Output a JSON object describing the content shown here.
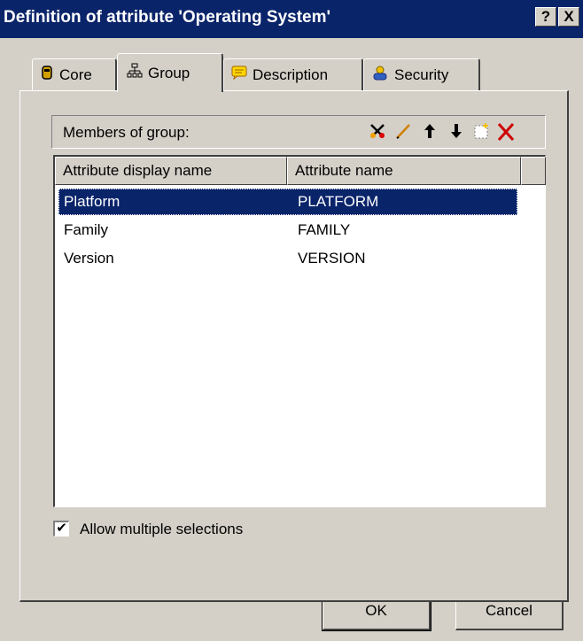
{
  "window": {
    "title": "Definition of attribute 'Operating System'",
    "help_label": "?",
    "close_label": "X"
  },
  "tabs": [
    {
      "label": "Core",
      "icon": "core-icon"
    },
    {
      "label": "Group",
      "icon": "group-icon",
      "active": true
    },
    {
      "label": "Description",
      "icon": "description-icon"
    },
    {
      "label": "Security",
      "icon": "security-icon"
    }
  ],
  "members": {
    "label": "Members of group:",
    "toolbar_icons": [
      "cut-icon",
      "edit-icon",
      "up-arrow-icon",
      "down-arrow-icon",
      "new-icon",
      "delete-icon"
    ]
  },
  "list": {
    "columns": [
      "Attribute display name",
      "Attribute name"
    ],
    "rows": [
      {
        "display": "Platform",
        "name": "PLATFORM",
        "selected": true
      },
      {
        "display": "Family",
        "name": "FAMILY"
      },
      {
        "display": "Version",
        "name": "VERSION"
      }
    ]
  },
  "options": {
    "allow_multiple_label": "Allow multiple selections",
    "allow_multiple_checked": true,
    "check_mark": "✔"
  },
  "buttons": {
    "ok": "OK",
    "cancel": "Cancel"
  },
  "colors": {
    "titlebar": "#0a246a",
    "face": "#d4d0c8",
    "selection": "#0a246a",
    "delete_red": "#cc0000"
  }
}
